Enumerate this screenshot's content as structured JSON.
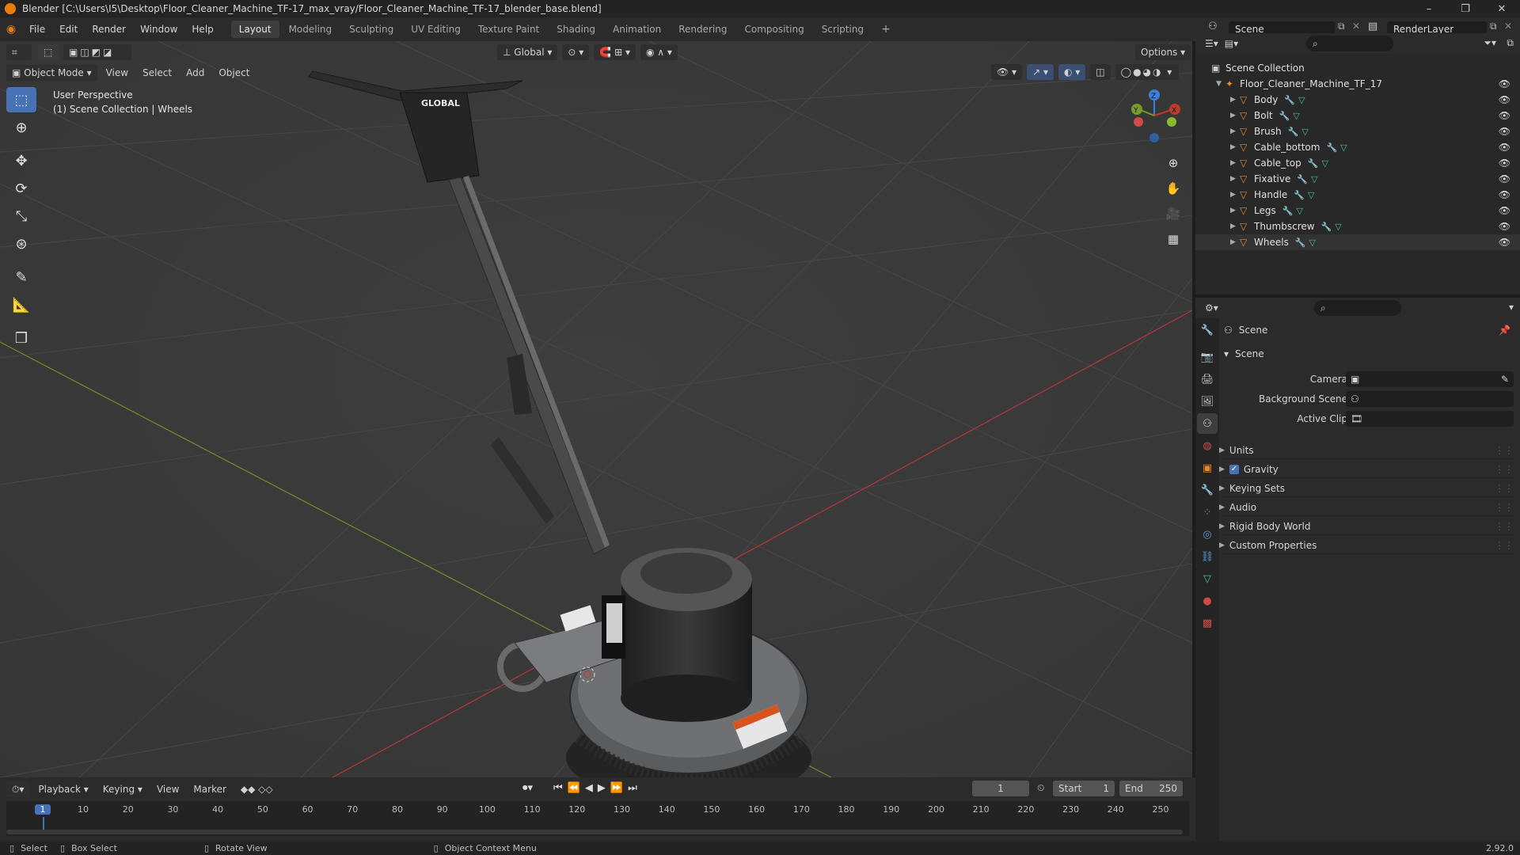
{
  "window": {
    "title": "Blender [C:\\Users\\I5\\Desktop\\Floor_Cleaner_Machine_TF-17_max_vray/Floor_Cleaner_Machine_TF-17_blender_base.blend]",
    "controls": [
      "–",
      "❐",
      "✕"
    ]
  },
  "menu": [
    "File",
    "Edit",
    "Render",
    "Window",
    "Help"
  ],
  "workspaces": [
    "Layout",
    "Modeling",
    "Sculpting",
    "UV Editing",
    "Texture Paint",
    "Shading",
    "Animation",
    "Rendering",
    "Compositing",
    "Scripting"
  ],
  "active_workspace": "Layout",
  "scene": {
    "name": "Scene",
    "render_layer": "RenderLayer"
  },
  "viewport": {
    "mode": "Object Mode",
    "header_menus": [
      "View",
      "Select",
      "Add",
      "Object"
    ],
    "transform_orientation": "Global",
    "options_label": "Options",
    "info_line1": "User Perspective",
    "info_line2": "(1) Scene Collection | Wheels",
    "model_brand": "GLOBAL"
  },
  "outliner": {
    "root": "Scene Collection",
    "collection": "Floor_Cleaner_Machine_TF_17",
    "objects": [
      "Body",
      "Bolt",
      "Brush",
      "Cable_bottom",
      "Cable_top",
      "Fixative",
      "Handle",
      "Legs",
      "Thumbscrew",
      "Wheels"
    ]
  },
  "properties": {
    "context_title": "Scene",
    "panel_title": "Scene",
    "fields": [
      {
        "label": "Camera",
        "value": ""
      },
      {
        "label": "Background Scene",
        "value": ""
      },
      {
        "label": "Active Clip",
        "value": ""
      }
    ],
    "subpanels": [
      "Units",
      "Gravity",
      "Keying Sets",
      "Audio",
      "Rigid Body World",
      "Custom Properties"
    ],
    "gravity_checked": true
  },
  "timeline": {
    "menus": [
      "Playback",
      "Keying",
      "View",
      "Marker"
    ],
    "current_frame": "1",
    "start_label": "Start",
    "start_value": "1",
    "end_label": "End",
    "end_value": "250",
    "ticks": [
      "1",
      "10",
      "20",
      "30",
      "40",
      "50",
      "60",
      "70",
      "80",
      "90",
      "100",
      "110",
      "120",
      "130",
      "140",
      "150",
      "160",
      "170",
      "180",
      "190",
      "200",
      "210",
      "220",
      "230",
      "240",
      "250"
    ]
  },
  "status": {
    "select": "Select",
    "box_select": "Box Select",
    "rotate_view": "Rotate View",
    "context_menu": "Object Context Menu",
    "version": "2.92.0"
  },
  "colors": {
    "accent": "#4772b3",
    "object_icon": "#e58a28",
    "x_axis": "#c0392b",
    "y_axis": "#7a9a2a",
    "frame_indicator": "#4772b3"
  }
}
